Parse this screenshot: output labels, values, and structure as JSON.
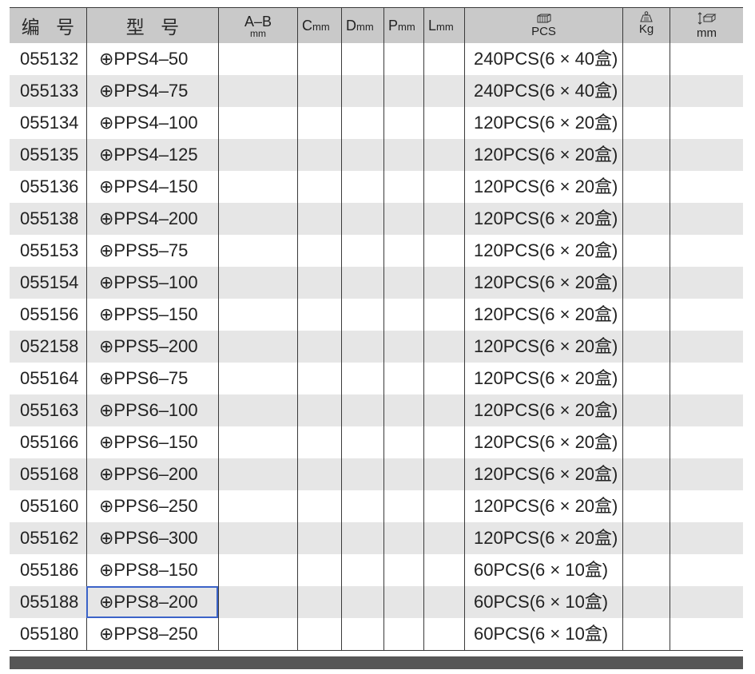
{
  "colors": {
    "header_bg": "#c9c9c9",
    "row_bg": "#ffffff",
    "row_alt_bg": "#e6e6e6",
    "grid_line": "#3a3a3a",
    "selection": "#3b63c8",
    "footer_bar": "#565656"
  },
  "table": {
    "headers": [
      {
        "key": "code",
        "label": "编 号"
      },
      {
        "key": "model",
        "label": "型 号"
      },
      {
        "key": "ab",
        "label": "A–B",
        "unit": "mm"
      },
      {
        "key": "c",
        "label": "C",
        "unit": "mm"
      },
      {
        "key": "d",
        "label": "D",
        "unit": "mm"
      },
      {
        "key": "p",
        "label": "P",
        "unit": "mm"
      },
      {
        "key": "l",
        "label": "L",
        "unit": "mm"
      },
      {
        "key": "pack",
        "icon": "box-icon",
        "unit": "PCS"
      },
      {
        "key": "weight",
        "icon": "weight-icon",
        "unit": "Kg"
      },
      {
        "key": "size",
        "icon": "dimension-icon",
        "unit": "mm"
      }
    ],
    "rows": [
      {
        "code": "055132",
        "model": "⊕PPS4–50",
        "pack": "240PCS(6 × 40盒)"
      },
      {
        "code": "055133",
        "model": "⊕PPS4–75",
        "pack": "240PCS(6 × 40盒)"
      },
      {
        "code": "055134",
        "model": "⊕PPS4–100",
        "pack": "120PCS(6 × 20盒)"
      },
      {
        "code": "055135",
        "model": "⊕PPS4–125",
        "pack": "120PCS(6 × 20盒)"
      },
      {
        "code": "055136",
        "model": "⊕PPS4–150",
        "pack": "120PCS(6 × 20盒)"
      },
      {
        "code": "055138",
        "model": "⊕PPS4–200",
        "pack": "120PCS(6 × 20盒)"
      },
      {
        "code": "055153",
        "model": "⊕PPS5–75",
        "pack": "120PCS(6 × 20盒)"
      },
      {
        "code": "055154",
        "model": "⊕PPS5–100",
        "pack": "120PCS(6 × 20盒)"
      },
      {
        "code": "055156",
        "model": "⊕PPS5–150",
        "pack": "120PCS(6 × 20盒)"
      },
      {
        "code": "052158",
        "model": "⊕PPS5–200",
        "pack": "120PCS(6 × 20盒)"
      },
      {
        "code": "055164",
        "model": "⊕PPS6–75",
        "pack": "120PCS(6 × 20盒)"
      },
      {
        "code": "055163",
        "model": "⊕PPS6–100",
        "pack": "120PCS(6 × 20盒)"
      },
      {
        "code": "055166",
        "model": "⊕PPS6–150",
        "pack": "120PCS(6 × 20盒)"
      },
      {
        "code": "055168",
        "model": "⊕PPS6–200",
        "pack": "120PCS(6 × 20盒)"
      },
      {
        "code": "055160",
        "model": "⊕PPS6–250",
        "pack": "120PCS(6 × 20盒)"
      },
      {
        "code": "055162",
        "model": "⊕PPS6–300",
        "pack": "120PCS(6 × 20盒)"
      },
      {
        "code": "055186",
        "model": "⊕PPS8–150",
        "pack": "60PCS(6 × 10盒)"
      },
      {
        "code": "055188",
        "model": "⊕PPS8–200",
        "pack": "60PCS(6 × 10盒)"
      },
      {
        "code": "055180",
        "model": "⊕PPS8–250",
        "pack": "60PCS(6 × 10盒)"
      }
    ],
    "selection": {
      "row_code": "055188",
      "column": "model"
    }
  }
}
